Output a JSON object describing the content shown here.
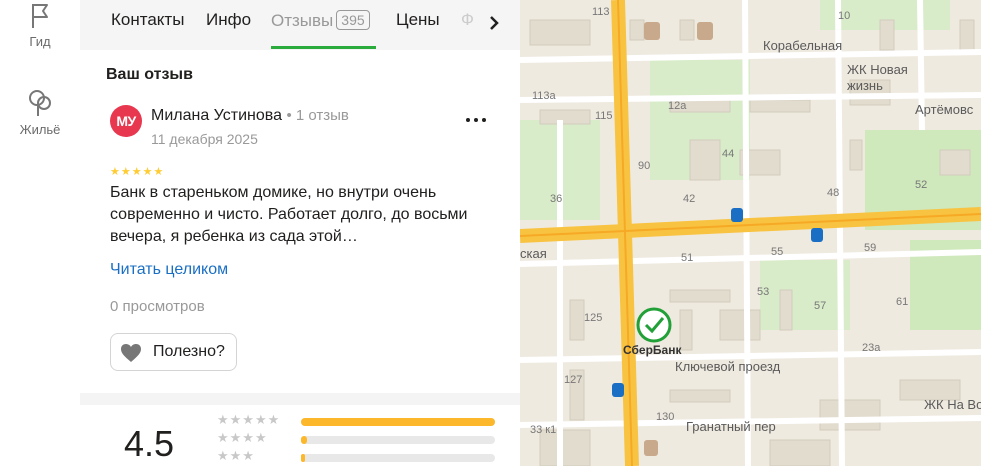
{
  "rail": {
    "items": [
      {
        "label": "Гид",
        "icon": "flag-icon"
      },
      {
        "label": "Жильё",
        "icon": "tree-icon"
      }
    ]
  },
  "tabs": {
    "items": [
      {
        "label": "Контакты"
      },
      {
        "label": "Инфо"
      },
      {
        "label": "Отзывы",
        "count": "395",
        "active": true
      },
      {
        "label": "Цены"
      },
      {
        "label": "Ф"
      }
    ]
  },
  "review": {
    "section_title": "Ваш отзыв",
    "avatar_initials": "МУ",
    "author": "Милана Устинова",
    "author_count": "1 отзыв",
    "date": "11 декабря 2025",
    "stars": "★★★★★",
    "text": "Банк в старенькoм домике, но внутри очень современно и чисто. Работает долго, до восьми вечера, я ребенка из сада этой…",
    "read_more": "Читать целиком",
    "views": "0 просмотров",
    "useful_label": "Полезно?"
  },
  "rating": {
    "value": "4.5",
    "rows": [
      {
        "stars": "★★★★★",
        "fraction": 1.0
      },
      {
        "stars": "★★★★",
        "fraction": 0.03
      },
      {
        "stars": "★★★",
        "fraction": 0.02
      }
    ],
    "accent": "#fcb72a"
  },
  "map": {
    "streets": [
      "Корабельная",
      "Артёмовс",
      "Ключевой проезд",
      "Гранатный пер",
      "ская"
    ],
    "places": [
      "ЖК Новая жизнь",
      "СберБанк",
      "ЖК На Во"
    ],
    "house_numbers": [
      "113",
      "10",
      "113а",
      "12а",
      "115",
      "90",
      "44",
      "36",
      "42",
      "48",
      "52",
      "51",
      "55",
      "59",
      "53",
      "125",
      "57",
      "61",
      "127",
      "130",
      "23а",
      "33 к1"
    ]
  }
}
